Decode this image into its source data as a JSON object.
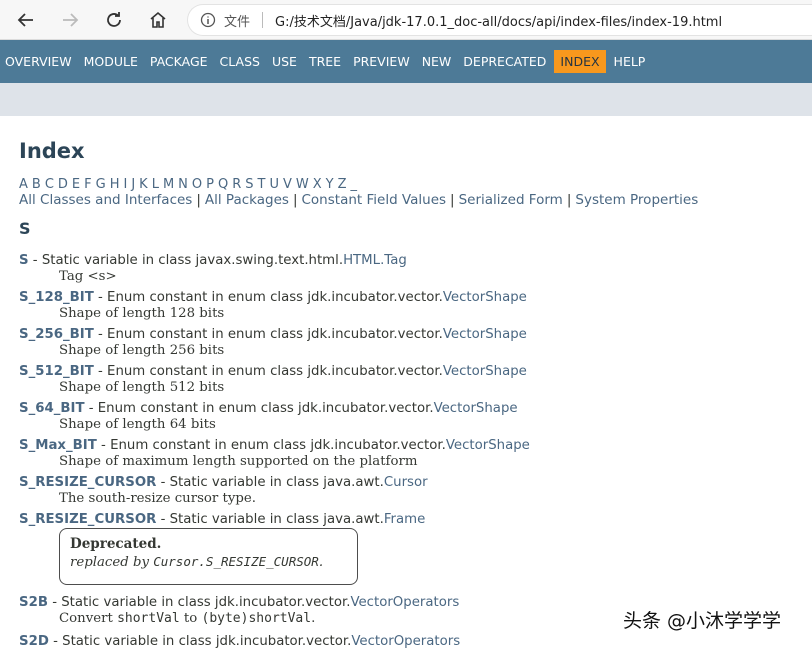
{
  "browser": {
    "address_prefix": "文件",
    "url": "G:/技术文档/Java/jdk-17.0.1_doc-all/docs/api/index-files/index-19.html"
  },
  "topnav": {
    "items": [
      "OVERVIEW",
      "MODULE",
      "PACKAGE",
      "CLASS",
      "USE",
      "TREE",
      "PREVIEW",
      "NEW",
      "DEPRECATED",
      "INDEX",
      "HELP"
    ],
    "active": "INDEX"
  },
  "page": {
    "title": "Index",
    "letters": [
      "A",
      "B",
      "C",
      "D",
      "E",
      "F",
      "G",
      "H",
      "I",
      "J",
      "K",
      "L",
      "M",
      "N",
      "O",
      "P",
      "Q",
      "R",
      "S",
      "T",
      "U",
      "V",
      "W",
      "X",
      "Y",
      "Z",
      "_"
    ],
    "links": [
      "All Classes and Interfaces",
      "All Packages",
      "Constant Field Values",
      "Serialized Form",
      "System Properties"
    ],
    "section_letter": "S"
  },
  "entries": [
    {
      "term": "S",
      "middle": " - Static variable in class javax.swing.text.html.",
      "owner": "HTML.Tag",
      "desc": "Tag <s>"
    },
    {
      "term": "S_128_BIT",
      "middle": " - Enum constant in enum class jdk.incubator.vector.",
      "owner": "VectorShape",
      "desc": "Shape of length 128 bits"
    },
    {
      "term": "S_256_BIT",
      "middle": " - Enum constant in enum class jdk.incubator.vector.",
      "owner": "VectorShape",
      "desc": "Shape of length 256 bits"
    },
    {
      "term": "S_512_BIT",
      "middle": " - Enum constant in enum class jdk.incubator.vector.",
      "owner": "VectorShape",
      "desc": "Shape of length 512 bits"
    },
    {
      "term": "S_64_BIT",
      "middle": " - Enum constant in enum class jdk.incubator.vector.",
      "owner": "VectorShape",
      "desc": "Shape of length 64 bits"
    },
    {
      "term": "S_Max_BIT",
      "middle": " - Enum constant in enum class jdk.incubator.vector.",
      "owner": "VectorShape",
      "desc": "Shape of maximum length supported on the platform"
    },
    {
      "term": "S_RESIZE_CURSOR",
      "middle": " - Static variable in class java.awt.",
      "owner": "Cursor",
      "desc": "The south-resize cursor type."
    },
    {
      "term": "S_RESIZE_CURSOR",
      "middle": " - Static variable in class java.awt.",
      "owner": "Frame",
      "desc": ""
    },
    {
      "term": "S2B",
      "middle": " - Static variable in class jdk.incubator.vector.",
      "owner": "VectorOperators",
      "desc_parts": [
        "Convert ",
        "shortVal",
        " to ",
        "(byte)shortVal",
        "."
      ]
    },
    {
      "term": "S2D",
      "middle": " - Static variable in class jdk.incubator.vector.",
      "owner": "VectorOperators",
      "desc": ""
    }
  ],
  "deprecated": {
    "label": "Deprecated.",
    "text_prefix": "replaced by ",
    "code": "Cursor.S_RESIZE_CURSOR",
    "text_suffix": "."
  },
  "watermark": "头条 @小沐学学学"
}
